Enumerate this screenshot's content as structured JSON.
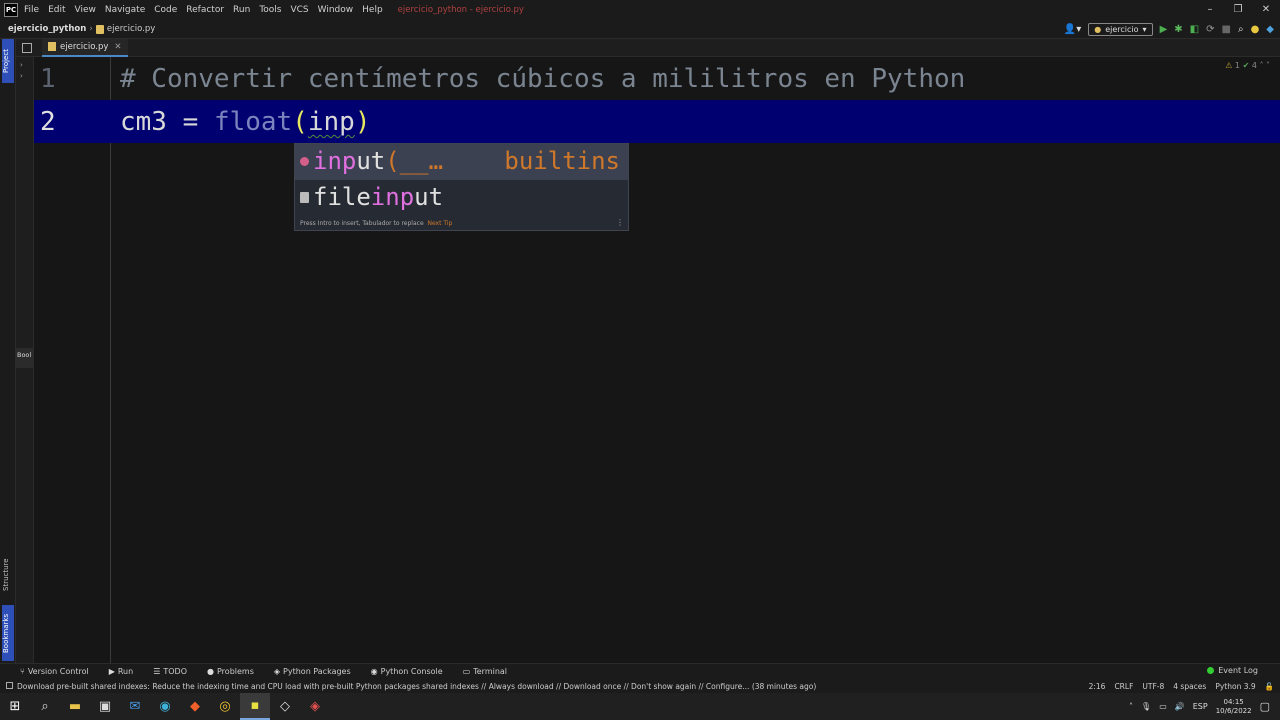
{
  "menubar": {
    "items": [
      "File",
      "Edit",
      "View",
      "Navigate",
      "Code",
      "Refactor",
      "Run",
      "Tools",
      "VCS",
      "Window",
      "Help"
    ],
    "window_title": "ejercicio_python - ejercicio.py"
  },
  "navbar": {
    "project": "ejercicio_python",
    "file": "ejercicio.py",
    "run_config": "ejercicio"
  },
  "sidebar": {
    "project_tab": "Project",
    "structure_tab": "Structure",
    "bookmarks_tab": "Bookmarks",
    "book_label": "Bool"
  },
  "tabs": [
    {
      "label": "ejercicio.py"
    }
  ],
  "editor": {
    "inspections": {
      "warnings": "1",
      "ok": "4"
    },
    "lines": [
      {
        "number": "1",
        "text": "# Convertir centímetros cúbicos a mililitros en Python"
      },
      {
        "number": "2",
        "id": "cm3",
        "op": " = ",
        "fn": "float",
        "open": "(",
        "arg": "inp",
        "close": ")"
      }
    ]
  },
  "completion": {
    "items": [
      {
        "match": "inp",
        "rest": "ut",
        "suffix": "(__…",
        "type": "builtins"
      },
      {
        "prefix": "file",
        "match": "inp",
        "rest": "ut"
      }
    ],
    "footer": "Press Intro to insert, Tabulador to replace",
    "next_tip": "Next Tip"
  },
  "toolwindows": [
    "Version Control",
    "Run",
    "TODO",
    "Problems",
    "Python Packages",
    "Python Console",
    "Terminal"
  ],
  "event_log": "Event Log",
  "status": {
    "message": "Download pre-built shared indexes: Reduce the indexing time and CPU load with pre-built Python packages shared indexes // Always download // Download once // Don't show again // Configure... (38 minutes ago)",
    "position": "2:16",
    "line_sep": "CRLF",
    "encoding": "UTF-8",
    "indent": "4 spaces",
    "interpreter": "Python 3.9"
  },
  "taskbar": {
    "lang": "ESP",
    "time": "04:15",
    "date": "10/6/2022"
  }
}
